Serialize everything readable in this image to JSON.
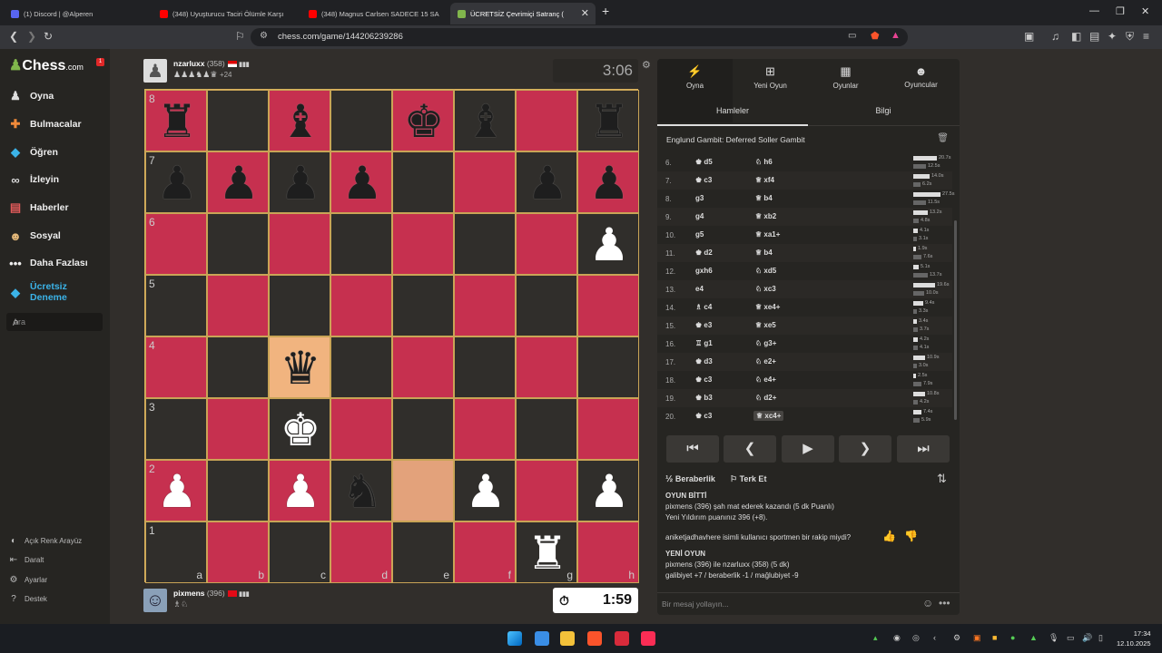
{
  "browser": {
    "tabs": [
      {
        "title": "(1) Discord | @Alperen",
        "color": "#5865f2"
      },
      {
        "title": "(348) Uyuşturucu Taciri Ölümle Karşı",
        "color": "#ff0000"
      },
      {
        "title": "(348) Magnus Carlsen SADECE 15 SA",
        "color": "#ff0000"
      },
      {
        "title": "ÜCRETSİZ Çevrimiçi Satranç (",
        "color": "#81b64c"
      }
    ],
    "url": "chess.com/game/144206239286"
  },
  "sidebar": {
    "logo": "Chess",
    "logo_suffix": ".com",
    "notif": "1",
    "items": [
      {
        "label": "Oyna",
        "icon": "pawn-icon"
      },
      {
        "label": "Bulmacalar",
        "icon": "puzzle-icon"
      },
      {
        "label": "Öğren",
        "icon": "learn-icon"
      },
      {
        "label": "İzleyin",
        "icon": "binoculars-icon"
      },
      {
        "label": "Haberler",
        "icon": "news-icon"
      },
      {
        "label": "Sosyal",
        "icon": "social-icon"
      },
      {
        "label": "Daha Fazlası",
        "icon": "more-icon"
      }
    ],
    "premium": "Ücretsiz Deneme",
    "premium_line1": "Ücretsiz",
    "premium_line2": "Deneme",
    "search_placeholder": "Ara",
    "bottom": [
      "Açık Renk Arayüz",
      "Daralt",
      "Ayarlar",
      "Destek"
    ]
  },
  "top_player": {
    "name": "nzarluxx",
    "rating": "(358)",
    "captured": "♟♟♟♞♟♛",
    "adv": "+24",
    "clock": "3:06"
  },
  "bottom_player": {
    "name": "pixmens",
    "rating": "(396)",
    "captured": "♗♘",
    "clock": "1:59"
  },
  "board": {
    "ranks": [
      "8",
      "7",
      "6",
      "5",
      "4",
      "3",
      "2",
      "1"
    ],
    "files": [
      "a",
      "b",
      "c",
      "d",
      "e",
      "f",
      "g",
      "h"
    ],
    "pieces": {
      "a8": "b♜",
      "c8": "b♝",
      "e8": "b♚",
      "f8": "b♝",
      "h8": "b♜",
      "a7": "b♟",
      "b7": "b♟",
      "c7": "b♟",
      "d7": "b♟",
      "g7": "b♟",
      "h7": "b♟",
      "h6": "w♟",
      "c4": "b♛",
      "c3": "w♚",
      "a2": "w♟",
      "c2": "w♟",
      "d2": "b♞",
      "f2": "w♟",
      "h2": "w♟",
      "g1": "w♜"
    },
    "highlight_light": [
      "c4"
    ],
    "highlight_dark": [
      "e2"
    ]
  },
  "panel": {
    "tabs": [
      "Oyna",
      "Yeni Oyun",
      "Oyunlar",
      "Oyuncular"
    ],
    "subtabs": [
      "Hamleler",
      "Bilgi"
    ],
    "opening": "Englund Gambit: Deferred Soller Gambit",
    "moves": [
      {
        "n": "6.",
        "w": "♚ d5",
        "b": "♘ h6",
        "tw": "20.7s",
        "tb": "12.5s",
        "bw": 26,
        "bb": 14
      },
      {
        "n": "7.",
        "w": "♚ c3",
        "b": "♕ xf4",
        "tw": "14.0s",
        "tb": "6.2s",
        "bw": 18,
        "bb": 8
      },
      {
        "n": "8.",
        "w": "g3",
        "b": "♕ b4",
        "tw": "27.5s",
        "tb": "11.5s",
        "bw": 30,
        "bb": 14
      },
      {
        "n": "9.",
        "w": "g4",
        "b": "♕ xb2",
        "tw": "13.2s",
        "tb": "4.8s",
        "bw": 16,
        "bb": 6
      },
      {
        "n": "10.",
        "w": "g5",
        "b": "♕ xa1+",
        "tw": "4.1s",
        "tb": "3.1s",
        "bw": 5,
        "bb": 4
      },
      {
        "n": "11.",
        "w": "♚ d2",
        "b": "♕ b4",
        "tw": "1.9s",
        "tb": "7.6s",
        "bw": 3,
        "bb": 9
      },
      {
        "n": "12.",
        "w": "gxh6",
        "b": "♘ xd5",
        "tw": "5.1s",
        "tb": "13.7s",
        "bw": 6,
        "bb": 16
      },
      {
        "n": "13.",
        "w": "e4",
        "b": "♘ xc3",
        "tw": "19.6s",
        "tb": "10.0s",
        "bw": 24,
        "bb": 12
      },
      {
        "n": "14.",
        "w": "♗ c4",
        "b": "♕ xe4+",
        "tw": "9.4s",
        "tb": "3.3s",
        "bw": 11,
        "bb": 4
      },
      {
        "n": "15.",
        "w": "♚ e3",
        "b": "♕ xe5",
        "tw": "3.4s",
        "tb": "3.7s",
        "bw": 4,
        "bb": 5
      },
      {
        "n": "16.",
        "w": "♖ g1",
        "b": "♘ g3+",
        "tw": "4.2s",
        "tb": "4.1s",
        "bw": 5,
        "bb": 5
      },
      {
        "n": "17.",
        "w": "♚ d3",
        "b": "♘ e2+",
        "tw": "10.9s",
        "tb": "3.0s",
        "bw": 13,
        "bb": 4
      },
      {
        "n": "18.",
        "w": "♚ c3",
        "b": "♘ e4+",
        "tw": "2.5s",
        "tb": "7.9s",
        "bw": 3,
        "bb": 9
      },
      {
        "n": "19.",
        "w": "♚ b3",
        "b": "♘ d2+",
        "tw": "10.8s",
        "tb": "4.2s",
        "bw": 13,
        "bb": 5
      },
      {
        "n": "20.",
        "w": "♚ c3",
        "b": "♕ xc4+",
        "tw": "7.4s",
        "tb": "5.9s",
        "bw": 9,
        "bb": 7
      }
    ],
    "draw": "Beraberlik",
    "resign": "Terk Et",
    "chat": [
      {
        "t": "OYUN BİTTİ",
        "b": true
      },
      {
        "t": "pixmens (396) şah mat ederek kazandı (5 dk Puanlı)",
        "b": false
      },
      {
        "t": "Yeni Yıldırım puanınız 396 (+8).",
        "b": false
      },
      {
        "t": "aniketjadhavhere isimli kullanıcı sportmen bir rakip miydi?",
        "b": false
      },
      {
        "t": "YENİ OYUN",
        "b": true
      },
      {
        "t": "pixmens (396) ile nzarluxx (358) (5 dk)",
        "b": false
      },
      {
        "t": "galibiyet +7 / beraberlik -1 / mağlubiyet -9",
        "b": false
      }
    ],
    "message_placeholder": "Bir mesaj yollayın..."
  },
  "taskbar": {
    "time": "17:34",
    "date": "12.10.2025"
  }
}
